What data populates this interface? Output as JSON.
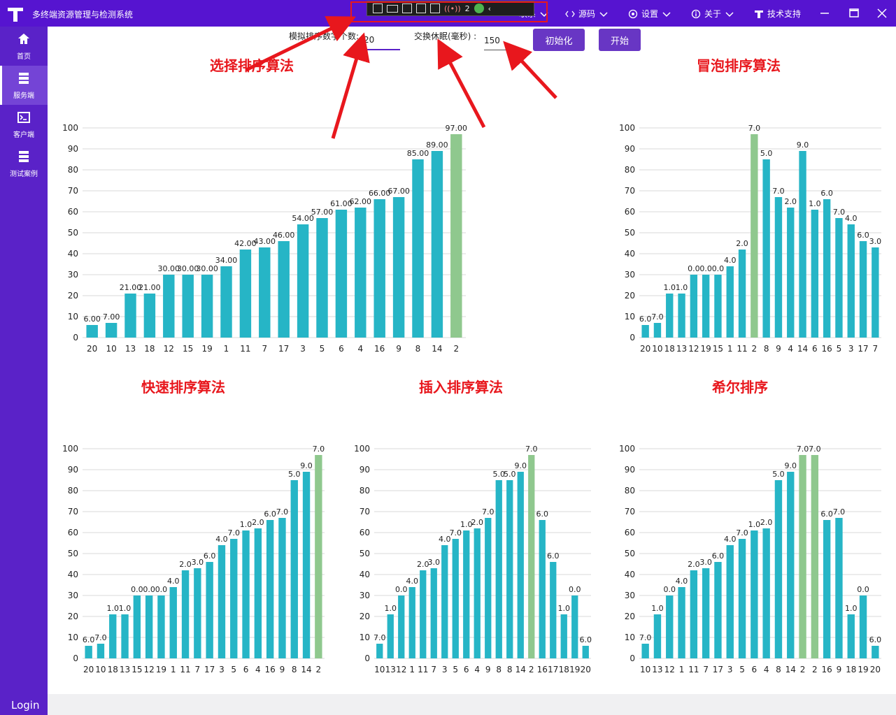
{
  "app": {
    "title": "多终端资源管理与检测系统"
  },
  "menu": [
    {
      "label": "联系",
      "icon": "contact-icon"
    },
    {
      "label": "源码",
      "icon": "code-icon"
    },
    {
      "label": "设置",
      "icon": "gear-icon"
    },
    {
      "label": "关于",
      "icon": "info-icon"
    },
    {
      "label": "技术支持",
      "icon": "brand-t-icon"
    }
  ],
  "devtoolbar": {
    "badge_count": "2"
  },
  "sidebar": {
    "items": [
      {
        "label": "首页",
        "icon": "home-icon"
      },
      {
        "label": "服务端",
        "icon": "server-icon"
      },
      {
        "label": "客户端",
        "icon": "terminal-icon"
      },
      {
        "label": "测试案例",
        "icon": "server-stack-icon"
      }
    ],
    "login": "Login"
  },
  "controls": {
    "count_label": "模拟排序数字个数:",
    "count_value": "20",
    "sleep_label": "交换休眠(毫秒) :",
    "sleep_value": "150",
    "init_button": "初始化",
    "start_button": "开始"
  },
  "colors": {
    "accent": "#5614d0",
    "bar": "#26b5c6",
    "highlight": "#8fc88e",
    "annotation": "#e8171d"
  },
  "chart_data": [
    {
      "type": "bar",
      "title": "选择排序算法",
      "ylim": [
        0,
        100
      ],
      "yticks": [
        0,
        10,
        20,
        30,
        40,
        50,
        60,
        70,
        80,
        90,
        100
      ],
      "categories": [
        "20",
        "10",
        "13",
        "18",
        "12",
        "15",
        "19",
        "1",
        "11",
        "7",
        "17",
        "3",
        "5",
        "6",
        "4",
        "16",
        "9",
        "8",
        "14",
        "2"
      ],
      "values": [
        6,
        7,
        21,
        21,
        30,
        30,
        30,
        34,
        42,
        43,
        46,
        54,
        57,
        61,
        62,
        66,
        67,
        85,
        89,
        97
      ],
      "labels": [
        "6.00",
        "7.00",
        "21.00",
        "21.00",
        "30.00",
        "30.00",
        "30.00",
        "34.00",
        "42.00",
        "43.00",
        "46.00",
        "54.00",
        "57.00",
        "61.00",
        "62.00",
        "66.00",
        "67.00",
        "85.00",
        "89.00",
        "97.00"
      ],
      "highlight": [
        19
      ]
    },
    {
      "type": "bar",
      "title": "冒泡排序算法",
      "ylim": [
        0,
        100
      ],
      "yticks": [
        0,
        10,
        20,
        30,
        40,
        50,
        60,
        70,
        80,
        90,
        100
      ],
      "categories": [
        "20",
        "10",
        "18",
        "13",
        "12",
        "19",
        "15",
        "1",
        "11",
        "2",
        "8",
        "9",
        "4",
        "14",
        "6",
        "16",
        "5",
        "3",
        "17",
        "7"
      ],
      "values": [
        6,
        7,
        21,
        21,
        30,
        30,
        30,
        34,
        42,
        97,
        85,
        67,
        62,
        89,
        61,
        66,
        57,
        54,
        46,
        43
      ],
      "labels": [
        "6.0",
        "7.0",
        "1.0",
        "1.0",
        "0.0",
        "0.0",
        "0.0",
        "4.0",
        "2.0",
        "7.0",
        "5.0",
        "7.0",
        "2.0",
        "9.0",
        "1.0",
        "6.0",
        "7.0",
        "4.0",
        "6.0",
        "3.0"
      ],
      "highlight": [
        9
      ]
    },
    {
      "type": "bar",
      "title": "快速排序算法",
      "ylim": [
        0,
        100
      ],
      "yticks": [
        0,
        10,
        20,
        30,
        40,
        50,
        60,
        70,
        80,
        90,
        100
      ],
      "categories": [
        "20",
        "10",
        "18",
        "13",
        "15",
        "12",
        "19",
        "1",
        "11",
        "7",
        "17",
        "3",
        "5",
        "6",
        "4",
        "16",
        "9",
        "8",
        "14",
        "2"
      ],
      "values": [
        6,
        7,
        21,
        21,
        30,
        30,
        30,
        34,
        42,
        43,
        46,
        54,
        57,
        61,
        62,
        66,
        67,
        85,
        89,
        97
      ],
      "labels": [
        "6.0",
        "7.0",
        "1.0",
        "1.0",
        "0.0",
        "0.0",
        "0.0",
        "4.0",
        "2.0",
        "3.0",
        "6.0",
        "4.0",
        "7.0",
        "1.0",
        "2.0",
        "6.0",
        "7.0",
        "5.0",
        "9.0",
        "7.0"
      ],
      "highlight": [
        19
      ]
    },
    {
      "type": "bar",
      "title": "插入排序算法",
      "ylim": [
        0,
        100
      ],
      "yticks": [
        0,
        10,
        20,
        30,
        40,
        50,
        60,
        70,
        80,
        90,
        100
      ],
      "categories": [
        "10",
        "13",
        "12",
        "1",
        "11",
        "7",
        "3",
        "5",
        "6",
        "4",
        "9",
        "8",
        "8",
        "14",
        "2",
        "16",
        "17",
        "18",
        "19",
        "20"
      ],
      "values": [
        7,
        21,
        30,
        34,
        42,
        43,
        54,
        57,
        61,
        62,
        67,
        85,
        85,
        89,
        97,
        66,
        46,
        21,
        30,
        6
      ],
      "labels": [
        "7.0",
        "1.0",
        "0.0",
        "4.0",
        "2.0",
        "3.0",
        "4.0",
        "7.0",
        "1.0",
        "2.0",
        "7.0",
        "5.0",
        "5.0",
        "9.0",
        "7.0",
        "6.0",
        "6.0",
        "1.0",
        "0.0",
        "6.0"
      ],
      "highlight": [
        14
      ]
    },
    {
      "type": "bar",
      "title": "希尔排序",
      "ylim": [
        0,
        100
      ],
      "yticks": [
        0,
        10,
        20,
        30,
        40,
        50,
        60,
        70,
        80,
        90,
        100
      ],
      "categories": [
        "10",
        "13",
        "12",
        "1",
        "11",
        "7",
        "17",
        "3",
        "5",
        "6",
        "4",
        "8",
        "14",
        "2",
        "2",
        "16",
        "9",
        "18",
        "19",
        "20"
      ],
      "values": [
        7,
        21,
        30,
        34,
        42,
        43,
        46,
        54,
        57,
        61,
        62,
        85,
        89,
        97,
        97,
        66,
        67,
        21,
        30,
        6
      ],
      "labels": [
        "7.0",
        "1.0",
        "0.0",
        "4.0",
        "2.0",
        "3.0",
        "6.0",
        "4.0",
        "7.0",
        "1.0",
        "2.0",
        "5.0",
        "9.0",
        "7.0",
        "7.0",
        "6.0",
        "7.0",
        "1.0",
        "0.0",
        "6.0"
      ],
      "highlight": [
        13,
        14
      ]
    }
  ]
}
